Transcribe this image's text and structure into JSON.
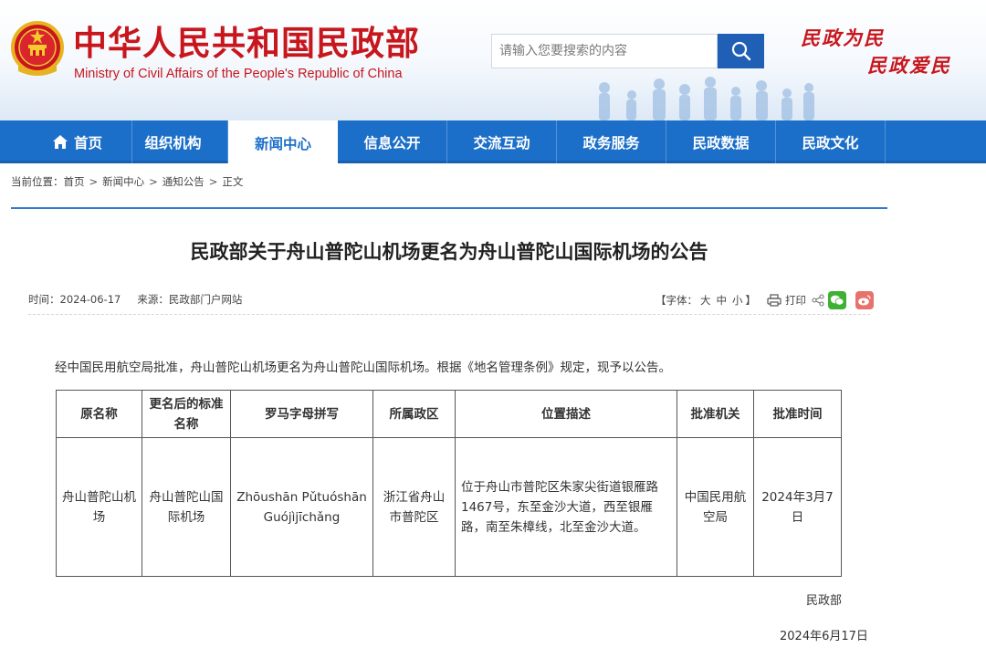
{
  "header": {
    "title_cn": "中华人民共和国民政部",
    "title_en": "Ministry of Civil Affairs of the People's Republic of China",
    "search_placeholder": "请输入您要搜索的内容",
    "slogan_line1": "民政为民",
    "slogan_line2": "民政爱民",
    "brand_color": "#c8161d"
  },
  "nav": {
    "items": [
      {
        "label": "首页",
        "icon": "home-icon"
      },
      {
        "label": "组织机构"
      },
      {
        "label": "新闻中心",
        "active": true
      },
      {
        "label": "信息公开"
      },
      {
        "label": "交流互动"
      },
      {
        "label": "政务服务"
      },
      {
        "label": "民政数据"
      },
      {
        "label": "民政文化"
      }
    ],
    "color": "#1c6fc8"
  },
  "breadcrumb": {
    "prefix": "当前位置：",
    "items": [
      "首页",
      "新闻中心",
      "通知公告",
      "正文"
    ],
    "separator": ">"
  },
  "article": {
    "title": "民政部关于舟山普陀山机场更名为舟山普陀山国际机场的公告",
    "time": "时间：2024-06-17",
    "source": "来源：民政部门户网站",
    "font_prefix": "【字体：",
    "font_large": "大",
    "font_medium": "中",
    "font_small": "小",
    "font_suffix": "】",
    "print_label": "打印",
    "intro": "经中国民用航空局批准，舟山普陀山机场更名为舟山普陀山国际机场。根据《地名管理条例》规定，现予以公告。",
    "table": {
      "headers": [
        "原名称",
        "更名后的标准名称",
        "罗马字母拼写",
        "所属政区",
        "位置描述",
        "批准机关",
        "批准时间"
      ],
      "row": {
        "original_name": "舟山普陀山机场",
        "new_name": "舟山普陀山国际机场",
        "romanization": "Zhōushān Pǔtuóshān Guójìjīchǎng",
        "region": "浙江省舟山市普陀区",
        "location": "位于舟山市普陀区朱家尖街道银雁路1467号，东至金沙大道，西至银雁路，南至朱樟线，北至金沙大道。",
        "authority": "中国民用航空局",
        "approval_date": "2024年3月7日"
      }
    },
    "signature_org": "民政部",
    "signature_date": "2024年6月17日"
  }
}
